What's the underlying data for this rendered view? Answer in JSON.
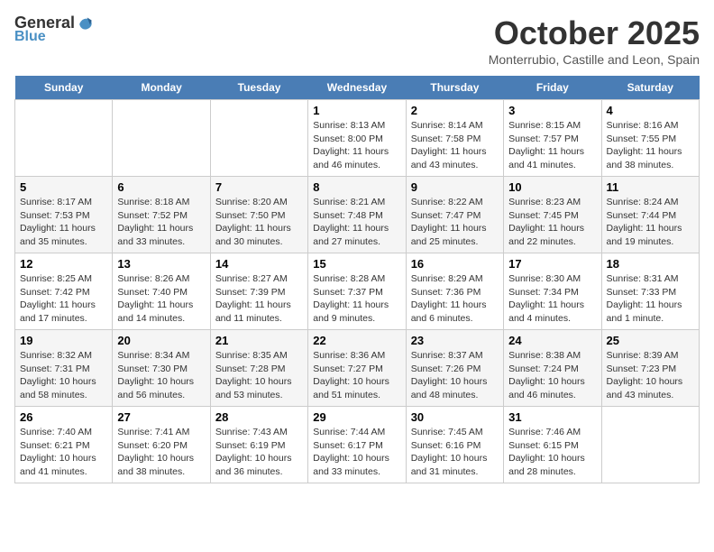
{
  "header": {
    "logo_line1": "General",
    "logo_line2": "Blue",
    "month": "October 2025",
    "location": "Monterrubio, Castille and Leon, Spain"
  },
  "weekdays": [
    "Sunday",
    "Monday",
    "Tuesday",
    "Wednesday",
    "Thursday",
    "Friday",
    "Saturday"
  ],
  "weeks": [
    [
      {
        "date": "",
        "sunrise": "",
        "sunset": "",
        "daylight": ""
      },
      {
        "date": "",
        "sunrise": "",
        "sunset": "",
        "daylight": ""
      },
      {
        "date": "",
        "sunrise": "",
        "sunset": "",
        "daylight": ""
      },
      {
        "date": "1",
        "sunrise": "Sunrise: 8:13 AM",
        "sunset": "Sunset: 8:00 PM",
        "daylight": "Daylight: 11 hours and 46 minutes."
      },
      {
        "date": "2",
        "sunrise": "Sunrise: 8:14 AM",
        "sunset": "Sunset: 7:58 PM",
        "daylight": "Daylight: 11 hours and 43 minutes."
      },
      {
        "date": "3",
        "sunrise": "Sunrise: 8:15 AM",
        "sunset": "Sunset: 7:57 PM",
        "daylight": "Daylight: 11 hours and 41 minutes."
      },
      {
        "date": "4",
        "sunrise": "Sunrise: 8:16 AM",
        "sunset": "Sunset: 7:55 PM",
        "daylight": "Daylight: 11 hours and 38 minutes."
      }
    ],
    [
      {
        "date": "5",
        "sunrise": "Sunrise: 8:17 AM",
        "sunset": "Sunset: 7:53 PM",
        "daylight": "Daylight: 11 hours and 35 minutes."
      },
      {
        "date": "6",
        "sunrise": "Sunrise: 8:18 AM",
        "sunset": "Sunset: 7:52 PM",
        "daylight": "Daylight: 11 hours and 33 minutes."
      },
      {
        "date": "7",
        "sunrise": "Sunrise: 8:20 AM",
        "sunset": "Sunset: 7:50 PM",
        "daylight": "Daylight: 11 hours and 30 minutes."
      },
      {
        "date": "8",
        "sunrise": "Sunrise: 8:21 AM",
        "sunset": "Sunset: 7:48 PM",
        "daylight": "Daylight: 11 hours and 27 minutes."
      },
      {
        "date": "9",
        "sunrise": "Sunrise: 8:22 AM",
        "sunset": "Sunset: 7:47 PM",
        "daylight": "Daylight: 11 hours and 25 minutes."
      },
      {
        "date": "10",
        "sunrise": "Sunrise: 8:23 AM",
        "sunset": "Sunset: 7:45 PM",
        "daylight": "Daylight: 11 hours and 22 minutes."
      },
      {
        "date": "11",
        "sunrise": "Sunrise: 8:24 AM",
        "sunset": "Sunset: 7:44 PM",
        "daylight": "Daylight: 11 hours and 19 minutes."
      }
    ],
    [
      {
        "date": "12",
        "sunrise": "Sunrise: 8:25 AM",
        "sunset": "Sunset: 7:42 PM",
        "daylight": "Daylight: 11 hours and 17 minutes."
      },
      {
        "date": "13",
        "sunrise": "Sunrise: 8:26 AM",
        "sunset": "Sunset: 7:40 PM",
        "daylight": "Daylight: 11 hours and 14 minutes."
      },
      {
        "date": "14",
        "sunrise": "Sunrise: 8:27 AM",
        "sunset": "Sunset: 7:39 PM",
        "daylight": "Daylight: 11 hours and 11 minutes."
      },
      {
        "date": "15",
        "sunrise": "Sunrise: 8:28 AM",
        "sunset": "Sunset: 7:37 PM",
        "daylight": "Daylight: 11 hours and 9 minutes."
      },
      {
        "date": "16",
        "sunrise": "Sunrise: 8:29 AM",
        "sunset": "Sunset: 7:36 PM",
        "daylight": "Daylight: 11 hours and 6 minutes."
      },
      {
        "date": "17",
        "sunrise": "Sunrise: 8:30 AM",
        "sunset": "Sunset: 7:34 PM",
        "daylight": "Daylight: 11 hours and 4 minutes."
      },
      {
        "date": "18",
        "sunrise": "Sunrise: 8:31 AM",
        "sunset": "Sunset: 7:33 PM",
        "daylight": "Daylight: 11 hours and 1 minute."
      }
    ],
    [
      {
        "date": "19",
        "sunrise": "Sunrise: 8:32 AM",
        "sunset": "Sunset: 7:31 PM",
        "daylight": "Daylight: 10 hours and 58 minutes."
      },
      {
        "date": "20",
        "sunrise": "Sunrise: 8:34 AM",
        "sunset": "Sunset: 7:30 PM",
        "daylight": "Daylight: 10 hours and 56 minutes."
      },
      {
        "date": "21",
        "sunrise": "Sunrise: 8:35 AM",
        "sunset": "Sunset: 7:28 PM",
        "daylight": "Daylight: 10 hours and 53 minutes."
      },
      {
        "date": "22",
        "sunrise": "Sunrise: 8:36 AM",
        "sunset": "Sunset: 7:27 PM",
        "daylight": "Daylight: 10 hours and 51 minutes."
      },
      {
        "date": "23",
        "sunrise": "Sunrise: 8:37 AM",
        "sunset": "Sunset: 7:26 PM",
        "daylight": "Daylight: 10 hours and 48 minutes."
      },
      {
        "date": "24",
        "sunrise": "Sunrise: 8:38 AM",
        "sunset": "Sunset: 7:24 PM",
        "daylight": "Daylight: 10 hours and 46 minutes."
      },
      {
        "date": "25",
        "sunrise": "Sunrise: 8:39 AM",
        "sunset": "Sunset: 7:23 PM",
        "daylight": "Daylight: 10 hours and 43 minutes."
      }
    ],
    [
      {
        "date": "26",
        "sunrise": "Sunrise: 7:40 AM",
        "sunset": "Sunset: 6:21 PM",
        "daylight": "Daylight: 10 hours and 41 minutes."
      },
      {
        "date": "27",
        "sunrise": "Sunrise: 7:41 AM",
        "sunset": "Sunset: 6:20 PM",
        "daylight": "Daylight: 10 hours and 38 minutes."
      },
      {
        "date": "28",
        "sunrise": "Sunrise: 7:43 AM",
        "sunset": "Sunset: 6:19 PM",
        "daylight": "Daylight: 10 hours and 36 minutes."
      },
      {
        "date": "29",
        "sunrise": "Sunrise: 7:44 AM",
        "sunset": "Sunset: 6:17 PM",
        "daylight": "Daylight: 10 hours and 33 minutes."
      },
      {
        "date": "30",
        "sunrise": "Sunrise: 7:45 AM",
        "sunset": "Sunset: 6:16 PM",
        "daylight": "Daylight: 10 hours and 31 minutes."
      },
      {
        "date": "31",
        "sunrise": "Sunrise: 7:46 AM",
        "sunset": "Sunset: 6:15 PM",
        "daylight": "Daylight: 10 hours and 28 minutes."
      },
      {
        "date": "",
        "sunrise": "",
        "sunset": "",
        "daylight": ""
      }
    ]
  ]
}
